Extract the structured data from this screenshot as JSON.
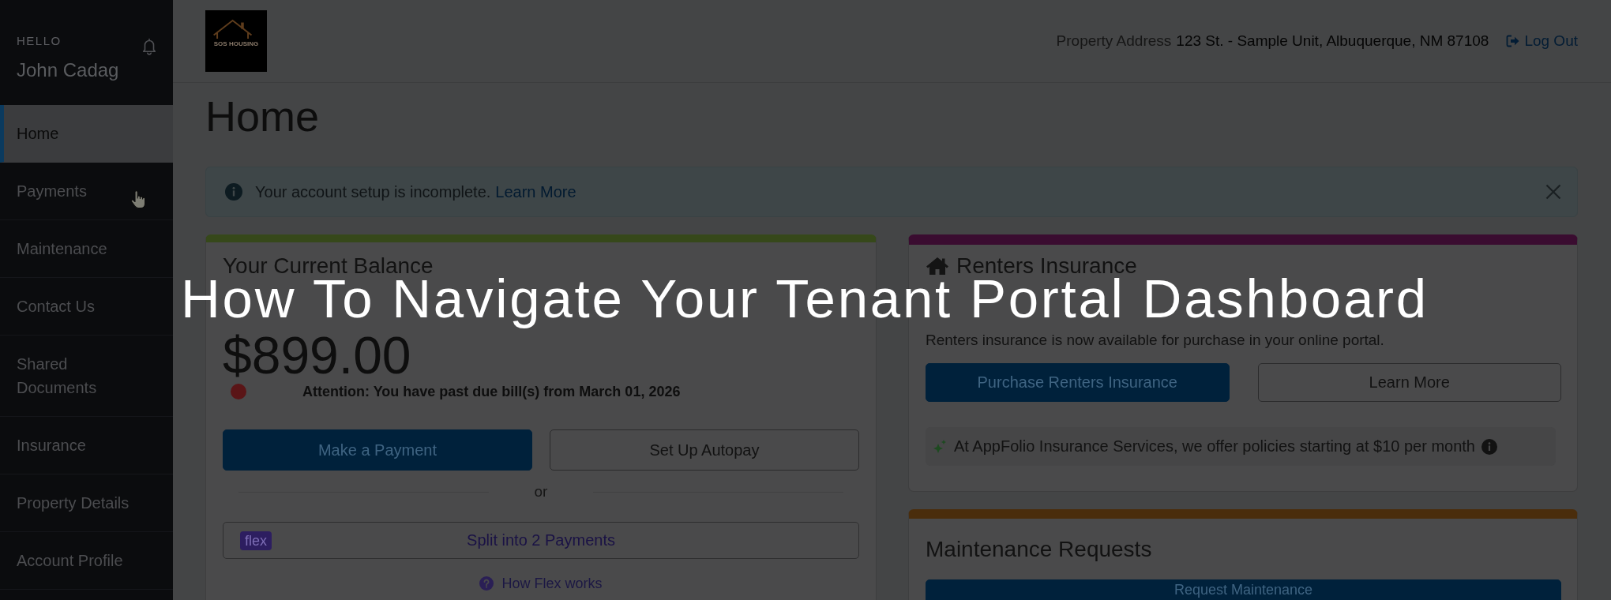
{
  "sidebar": {
    "greeting": "HELLO",
    "user_name": "John Cadag",
    "items": [
      {
        "label": "Home",
        "selected": true
      },
      {
        "label": "Payments",
        "selected": false
      },
      {
        "label": "Maintenance",
        "selected": false
      },
      {
        "label": "Contact Us",
        "selected": false
      },
      {
        "label": "Shared Documents",
        "selected": false
      },
      {
        "label": "Insurance",
        "selected": false
      },
      {
        "label": "Property Details",
        "selected": false
      },
      {
        "label": "Account Profile",
        "selected": false
      }
    ]
  },
  "header": {
    "logo_text": "SOS HOUSING",
    "address_label": "Property Address",
    "address": "123 St. - Sample Unit, Albuquerque, NM 87108",
    "logout": "Log Out"
  },
  "page_title": "Home",
  "alert": {
    "message": "Your account setup is incomplete.",
    "link": "Learn More"
  },
  "balance_card": {
    "title": "Your Current Balance",
    "amount": "$899.00",
    "notice": "Attention: You have past due bill(s) from March 01, 2026",
    "buttons": [
      {
        "label": "Make a Payment",
        "kind": "primary"
      },
      {
        "label": "Set Up Autopay",
        "kind": "outline"
      }
    ],
    "divider_text": "or",
    "flex_badge": "flex",
    "flex_button": "Split into 2 Payments",
    "flex_help": "How Flex works"
  },
  "insurance_card": {
    "title": "Renters Insurance",
    "description": "Renters insurance is now available for purchase in your online portal.",
    "buttons": [
      {
        "label": "Purchase Renters Insurance",
        "kind": "primary"
      },
      {
        "label": "Learn More",
        "kind": "outline"
      }
    ],
    "promo": "At AppFolio Insurance Services, we offer policies starting at $10 per month"
  },
  "maintenance_card": {
    "title": "Maintenance Requests",
    "button": {
      "label": "Request Maintenance",
      "kind": "primary"
    }
  },
  "overlay_title": "How To Navigate Your Tenant Portal Dashboard"
}
